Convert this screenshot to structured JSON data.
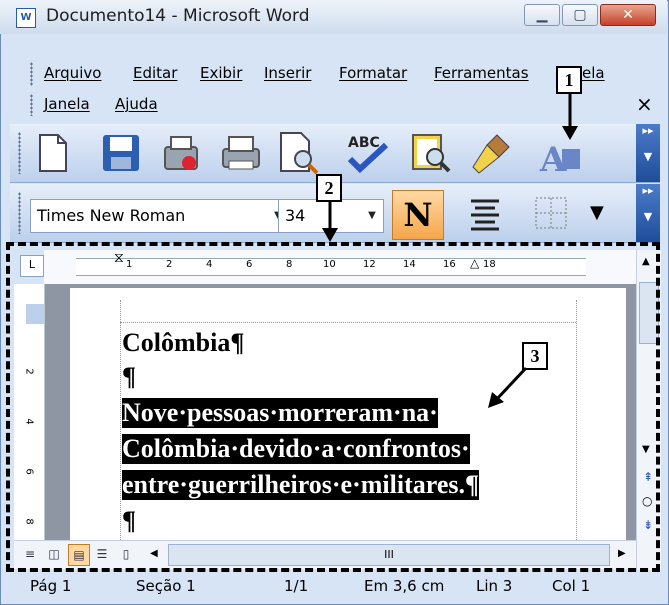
{
  "window": {
    "title": "Documento14 - Microsoft Word",
    "minimize_icon": "minimize-icon",
    "maximize_icon": "maximize-icon",
    "close_icon": "close-icon"
  },
  "menubar": {
    "items": [
      "Arquivo",
      "Editar",
      "Exibir",
      "Inserir",
      "Formatar",
      "Ferramentas",
      "Tabela",
      "Janela",
      "Ajuda"
    ],
    "visible_partial": [
      "ela"
    ],
    "close_label": "×"
  },
  "standard_toolbar": {
    "buttons": [
      "new-document-icon",
      "save-icon",
      "permission-icon",
      "print-icon",
      "print-preview-icon",
      "spelling-icon",
      "research-icon",
      "format-painter-icon",
      "styles-icon"
    ]
  },
  "formatting_toolbar": {
    "font_name": "Times New Roman",
    "font_size": "34",
    "bold_label": "N"
  },
  "ruler": {
    "ticks": [
      "1",
      "2",
      "4",
      "6",
      "8",
      "10",
      "12",
      "14",
      "16",
      "18"
    ],
    "tab_selector": "L"
  },
  "vertical_ruler": {
    "ticks": [
      "2",
      "4",
      "6",
      "8"
    ]
  },
  "document": {
    "heading": "Colômbia¶",
    "blank_paragraph": "¶",
    "selected_lines": [
      "Nove·pessoas·morreram·na·",
      "Colômbia·devido·a·confrontos·",
      "entre·guerrilheiros·e·militares.¶"
    ],
    "trailing_paragraph": "¶"
  },
  "scrollbar": {
    "horizontal_thumb": "III"
  },
  "statusbar": {
    "page": "Pág 1",
    "section": "Seção 1",
    "pages": "1/1",
    "position": "Em 3,6 cm",
    "line": "Lin 3",
    "column": "Col 1"
  },
  "callouts": [
    "1",
    "2",
    "3"
  ]
}
